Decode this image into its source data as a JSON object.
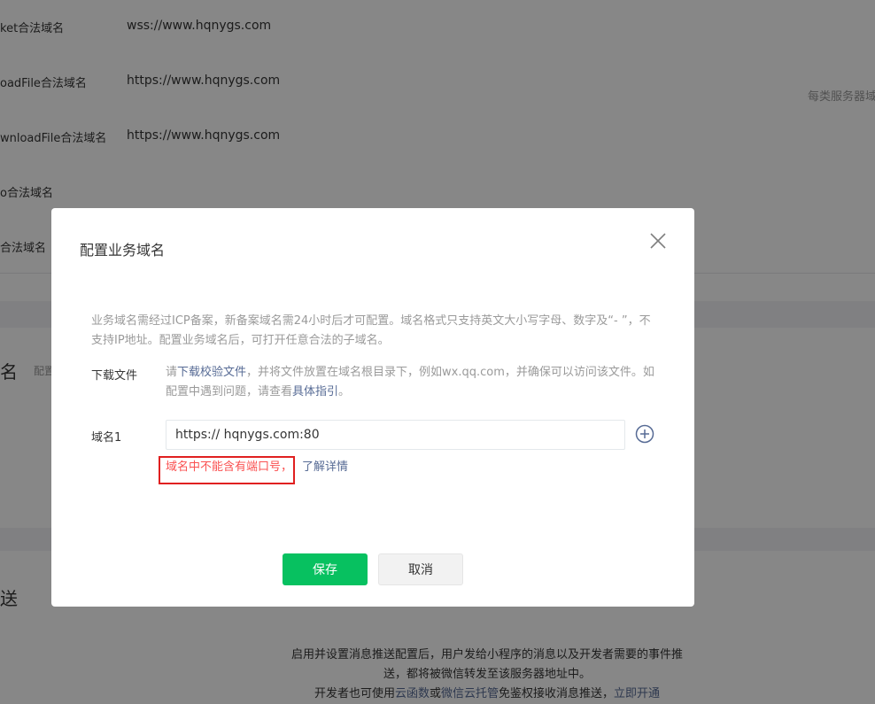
{
  "background": {
    "rows": [
      {
        "label": "ket合法域名",
        "value": "wss://www.hqnygs.com"
      },
      {
        "label": "oadFile合法域名",
        "value": "https://www.hqnygs.com"
      },
      {
        "label": "wnloadFile合法域名",
        "value": "https://www.hqnygs.com"
      },
      {
        "label": "o合法域名",
        "value": ""
      },
      {
        "label": "合法域名",
        "value": ""
      }
    ],
    "side_note": "每类服务器域",
    "section_title_1": "名",
    "section_sub_1": "配置",
    "section_title_2": "送",
    "footer_line1": "启用并设置消息推送配置后，用户发给小程序的消息以及开发者需要的事件推",
    "footer_line2": "送，都将被微信转发至该服务器地址中。",
    "footer_line3_prefix": "开发者也可使用",
    "footer_link1": "云函数",
    "footer_or": "或",
    "footer_link2": "微信云托管",
    "footer_line3_suffix": "免鉴权接收消息推送，",
    "footer_link3": "立即开通"
  },
  "modal": {
    "title": "配置业务域名",
    "description": "业务域名需经过ICP备案，新备案域名需24小时后才可配置。域名格式只支持英文大小写字母、数字及“- ”，不支持IP地址。配置业务域名后，可打开任意合法的子域名。",
    "download_label": "下载文件",
    "download_prefix": "请",
    "download_link": "下载校验文件",
    "download_middle": "，并将文件放置在域名根目录下，例如wx.qq.com，并确保可以访问该文件。如配置中遇到问题，请查看",
    "download_guide_link": "具体指引",
    "download_suffix": "。",
    "domain_label": "域名1",
    "domain_value": "https:// hqnygs.com:80",
    "error_text": "域名中不能含有端口号，",
    "error_link": "了解详情",
    "save_label": "保存",
    "cancel_label": "取消"
  },
  "colors": {
    "primary": "#07c160",
    "link": "#576b95",
    "error": "#fa5151",
    "highlight_box": "#e02020"
  },
  "icons": {
    "close": "close-icon",
    "add": "plus-circle-icon"
  }
}
